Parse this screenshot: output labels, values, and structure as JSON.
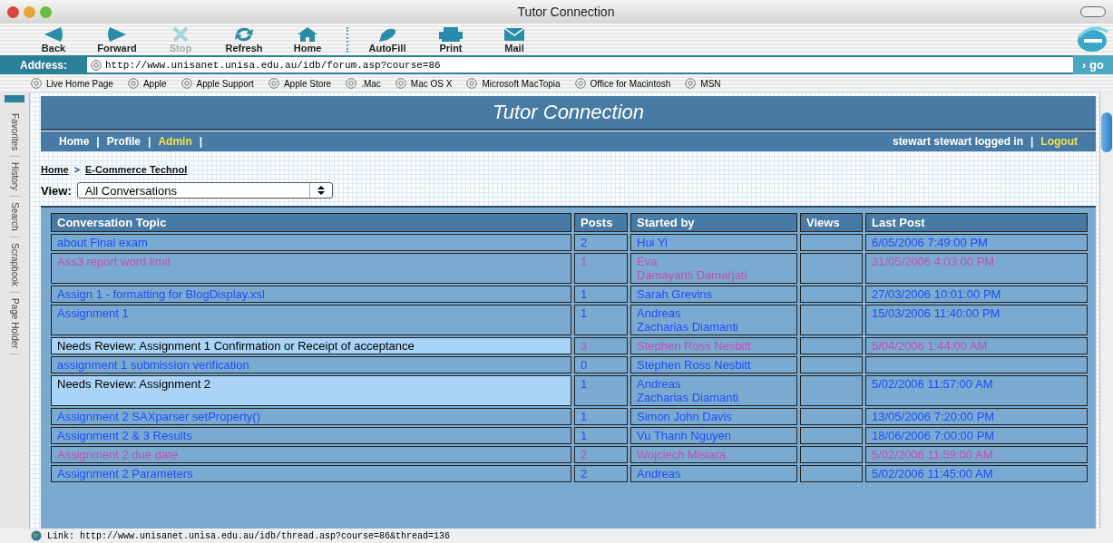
{
  "window": {
    "title": "Tutor Connection"
  },
  "toolbar": [
    {
      "label": "Back",
      "disabled": false
    },
    {
      "label": "Forward",
      "disabled": false
    },
    {
      "label": "Stop",
      "disabled": true
    },
    {
      "label": "Refresh",
      "disabled": false
    },
    {
      "label": "Home",
      "disabled": false
    },
    {
      "label": "AutoFill",
      "disabled": false
    },
    {
      "label": "Print",
      "disabled": false
    },
    {
      "label": "Mail",
      "disabled": false
    }
  ],
  "address": {
    "label": "Address:",
    "value": "http://www.unisanet.unisa.edu.au/idb/forum.asp?course=86",
    "go": "› go"
  },
  "favorites": [
    "Live Home Page",
    "Apple",
    "Apple Support",
    "Apple Store",
    ".Mac",
    "Mac OS X",
    "Microsoft MacTopia",
    "Office for Macintosh",
    "MSN"
  ],
  "side_tabs": [
    "Favorites",
    "History",
    "Search",
    "Scrapbook",
    "Page Holder"
  ],
  "site": {
    "title": "Tutor Connection",
    "nav": [
      {
        "label": "Home",
        "highlight": false
      },
      {
        "label": "Profile",
        "highlight": false
      },
      {
        "label": "Admin",
        "highlight": true
      }
    ],
    "separator": "|",
    "user": "stewart stewart logged in",
    "logout": "Logout"
  },
  "breadcrumb": {
    "items": [
      "Home",
      "E-Commerce Technol"
    ],
    "separator": ">"
  },
  "view": {
    "label": "View:",
    "value": "All Conversations"
  },
  "table": {
    "columns": [
      "Conversation Topic",
      "Posts",
      "Started by",
      "Views",
      "Last Post"
    ],
    "rows": [
      {
        "topic": "about Final exam",
        "posts": "2",
        "started_by": [
          "Hui Yi"
        ],
        "last_post": "6/05/2006 7:49:00 PM",
        "kind": "unread",
        "review": false
      },
      {
        "topic": "Ass3 report word limit",
        "posts": "1",
        "started_by": [
          "Eva",
          "Damayanti Damarjati"
        ],
        "last_post": "31/05/2006 4:03:00 PM",
        "kind": "read",
        "review": false
      },
      {
        "topic": "Assign 1 - formatting for BlogDisplay.xsl",
        "posts": "1",
        "started_by": [
          "Sarah Grevins"
        ],
        "last_post": "27/03/2006 10:01:00 PM",
        "kind": "unread",
        "review": false
      },
      {
        "topic": "Assignment 1",
        "posts": "1",
        "started_by": [
          "Andreas",
          "Zacharias Diamanti"
        ],
        "last_post": "15/03/2006 11:40:00 PM",
        "kind": "unread",
        "review": false
      },
      {
        "topic": "Needs Review: Assignment 1 Confirmation or Receipt of acceptance",
        "posts": "3",
        "started_by": [
          "Stephen Ross Nesbitt"
        ],
        "last_post": "5/04/2006 1:44:00 AM",
        "kind": "read",
        "review": true
      },
      {
        "topic": "assignment 1 submission verification",
        "posts": "0",
        "started_by": [
          "Stephen Ross Nesbitt"
        ],
        "kind": "unread",
        "review": false
      },
      {
        "topic": "Needs Review: Assignment 2",
        "posts": "1",
        "started_by": [
          "Andreas",
          "Zacharias Diamanti"
        ],
        "last_post": "5/02/2006 11:57:00 AM",
        "kind": "unread",
        "review": true
      },
      {
        "topic": "Assignment 2 SAXparser setProperty()",
        "posts": "1",
        "started_by": [
          "Simon John Davis"
        ],
        "last_post": "13/05/2006 7:20:00 PM",
        "kind": "unread",
        "review": false
      },
      {
        "topic": "Assignment 2 & 3 Results",
        "posts": "1",
        "started_by": [
          "Vu Thanh Nguyen"
        ],
        "last_post": "18/06/2006 7:00:00 PM",
        "kind": "unread",
        "review": false
      },
      {
        "topic": "Assignment 2 due date",
        "posts": "2",
        "started_by": [
          "Wojciech Misiara"
        ],
        "last_post": "5/02/2006 11:59:00 AM",
        "kind": "read",
        "review": false
      },
      {
        "topic": "Assignment 2 Parameters",
        "posts": "2",
        "started_by": [
          "Andreas"
        ],
        "last_post": "5/02/2006 11:45:00 AM",
        "kind": "unread",
        "review": false
      }
    ]
  },
  "status_bar": "Link: http://www.unisanet.unisa.edu.au/idb/thread.asp?course=86&thread=136"
}
